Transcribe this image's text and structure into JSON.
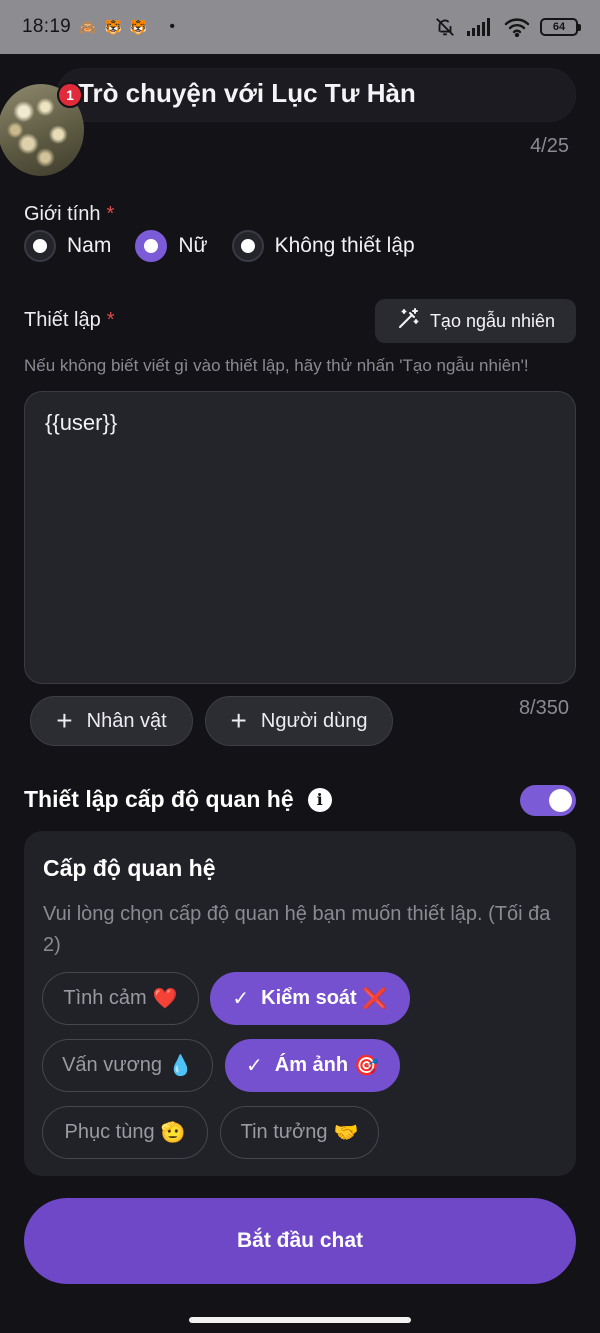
{
  "status_bar": {
    "time": "18:19",
    "app_icons": [
      "🙈",
      "🐯",
      "🐯"
    ],
    "dot": "•",
    "battery": "64"
  },
  "character": {
    "name": "Trò chuyện với Lục Tư Hàn",
    "notification_count": "1",
    "name_counter": "4/25"
  },
  "gender": {
    "label": "Giới tính",
    "required_mark": "*",
    "options": [
      {
        "label": "Nam",
        "selected": false
      },
      {
        "label": "Nữ",
        "selected": true
      },
      {
        "label": "Không thiết lập",
        "selected": false
      }
    ]
  },
  "setting": {
    "label": "Thiết lập",
    "required_mark": "*",
    "random_button": "Tạo ngẫu nhiên",
    "hint": "Nếu không biết viết gì vào thiết lập, hãy thử nhấn 'Tạo ngẫu nhiên'!",
    "value": "{{user}}",
    "add_character": "Nhân vật",
    "add_user": "Người dùng",
    "counter": "8/350"
  },
  "relationship": {
    "title": "Thiết lập cấp độ quan hệ",
    "info_icon_glyph": "i",
    "toggle_on": true,
    "card_title": "Cấp độ quan hệ",
    "card_desc": "Vui lòng chọn cấp độ quan hệ bạn muốn thiết lập. (Tối đa 2)",
    "check_glyph": "✓",
    "tags": [
      {
        "label": "Tình cảm",
        "emoji": "❤️",
        "selected": false
      },
      {
        "label": "Kiểm soát",
        "emoji": "❌",
        "selected": true
      },
      {
        "label": "Vấn vương",
        "emoji": "💧",
        "selected": false
      },
      {
        "label": "Ám ảnh",
        "emoji": "🎯",
        "selected": true
      },
      {
        "label": "Phục tùng",
        "emoji": "🫡",
        "selected": false
      },
      {
        "label": "Tin tưởng",
        "emoji": "🤝",
        "selected": false
      }
    ]
  },
  "start_button": "Bắt đầu chat",
  "colors": {
    "background": "#121217",
    "accent": "#7b5bd6",
    "required": "#e24b4b",
    "badge": "#e02b3a"
  }
}
